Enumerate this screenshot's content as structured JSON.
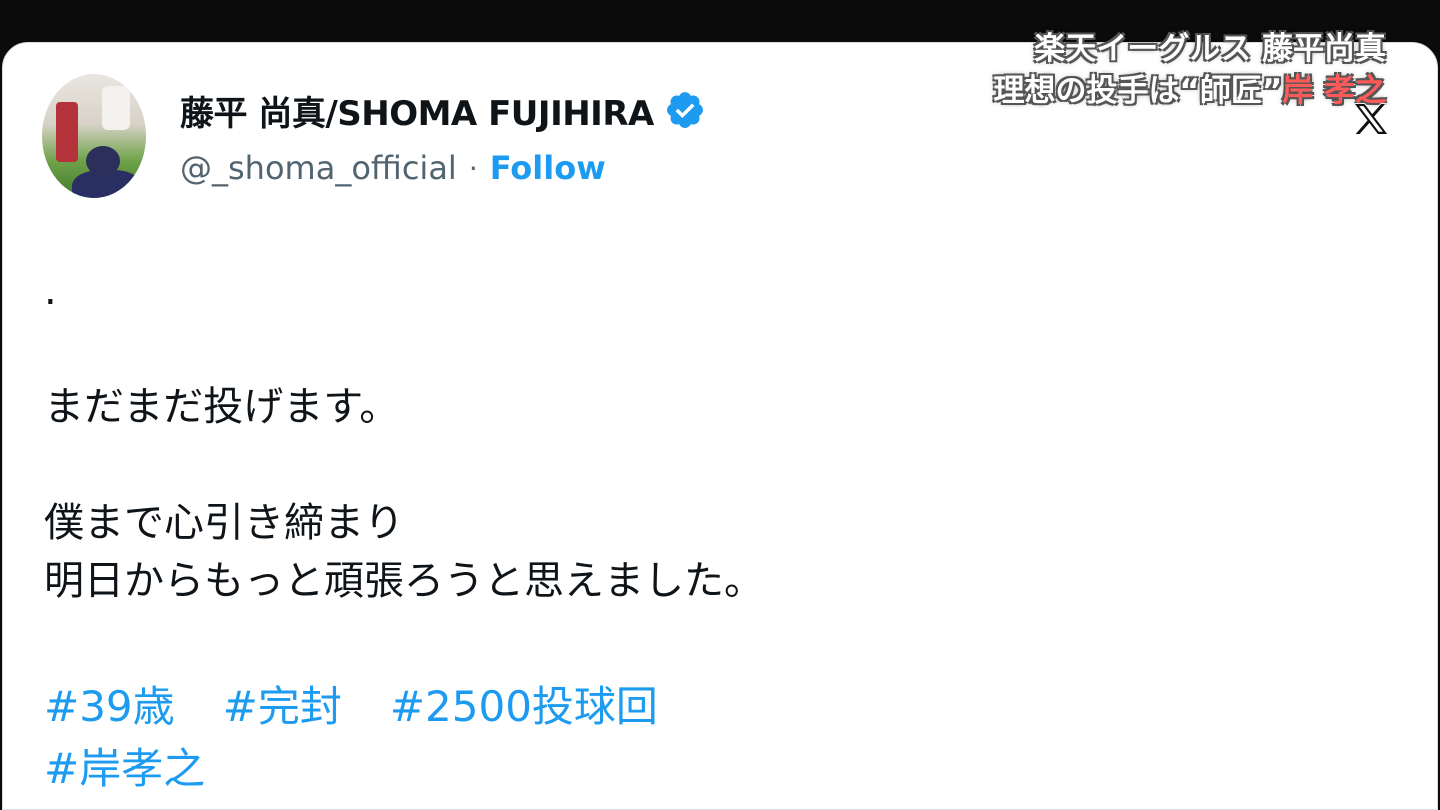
{
  "tweet": {
    "display_name": "藤平 尚真/SHOMA FUJIHIRA",
    "handle": "@_shoma_official",
    "separator": "·",
    "follow_label": "Follow",
    "verified": true,
    "text_lines": [
      ".",
      "",
      "まだまだ投げます。",
      "",
      "僕まで心引き締まり",
      "明日からもっと頑張ろうと思えました。"
    ],
    "hashtags_row1": [
      "#39歳",
      "#完封",
      "#2500投球回"
    ],
    "hashtags_row2": [
      "#岸孝之"
    ]
  },
  "overlay": {
    "line1": "楽天イーグルス 藤平尚真",
    "line2_prefix": "理想の投手は“師匠”",
    "line2_accent": "岸 孝之"
  },
  "colors": {
    "link": "#1d9bf0",
    "text": "#0f1419",
    "muted": "#536471",
    "accent": "#ff5a5a"
  },
  "icons": {
    "verified": "verified-badge-icon",
    "logo": "x-logo-icon"
  }
}
